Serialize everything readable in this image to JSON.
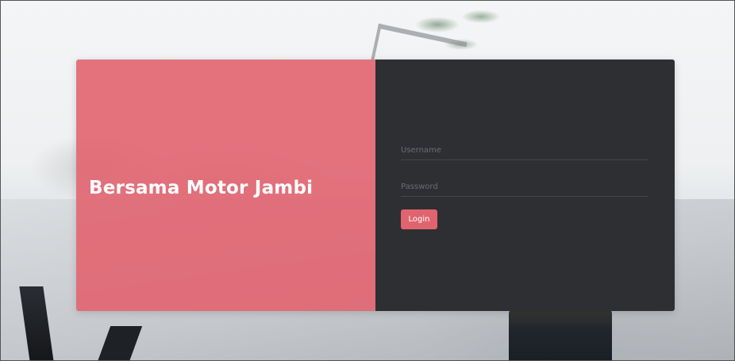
{
  "brand": {
    "title": "Bersama Motor Jambi"
  },
  "login_form": {
    "username_placeholder": "Username",
    "password_placeholder": "Password",
    "username_value": "",
    "password_value": "",
    "submit_label": "Login"
  },
  "colors": {
    "accent": "#e06470",
    "panel_dark": "#2e2f33",
    "brand_panel": "#e16470"
  }
}
